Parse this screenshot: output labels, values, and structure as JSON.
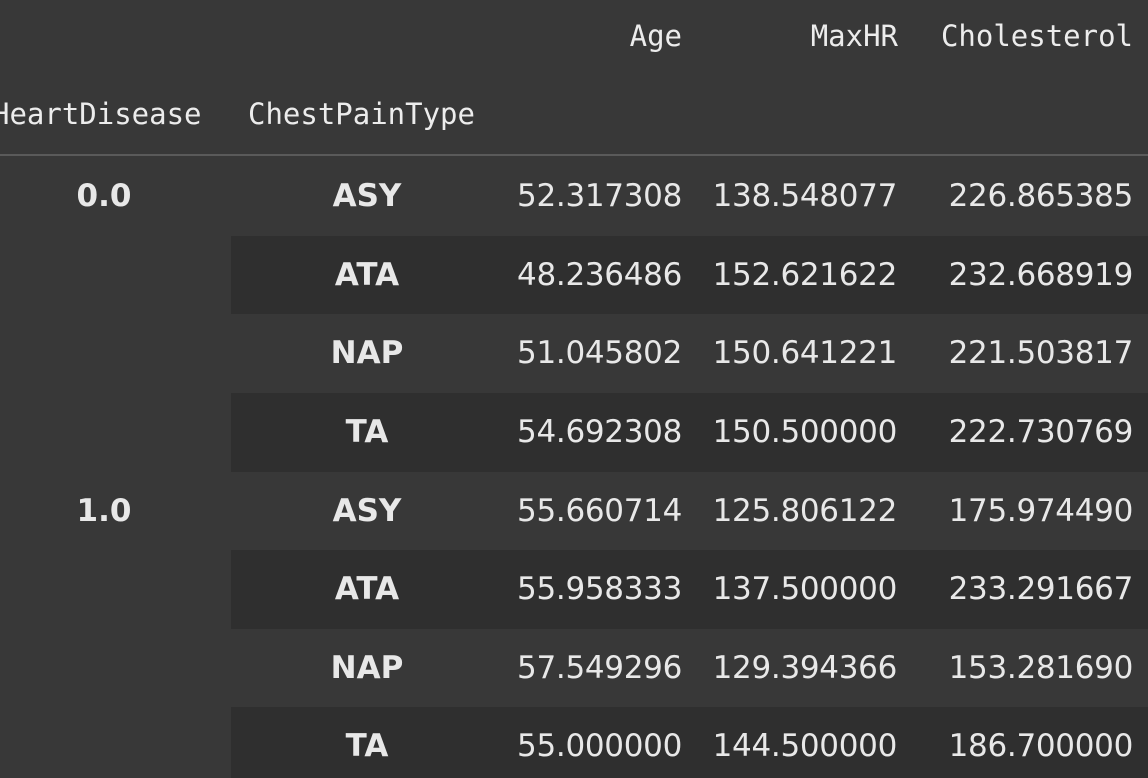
{
  "header": {
    "columns": [
      "Age",
      "MaxHR",
      "Cholesterol"
    ],
    "index_names": [
      "HeartDisease",
      "ChestPainType"
    ]
  },
  "rows": [
    {
      "HeartDisease": "0.0",
      "ChestPainType": "ASY",
      "Age": "52.317308",
      "MaxHR": "138.548077",
      "Cholesterol": "226.865385"
    },
    {
      "HeartDisease": "",
      "ChestPainType": "ATA",
      "Age": "48.236486",
      "MaxHR": "152.621622",
      "Cholesterol": "232.668919"
    },
    {
      "HeartDisease": "",
      "ChestPainType": "NAP",
      "Age": "51.045802",
      "MaxHR": "150.641221",
      "Cholesterol": "221.503817"
    },
    {
      "HeartDisease": "",
      "ChestPainType": "TA",
      "Age": "54.692308",
      "MaxHR": "150.500000",
      "Cholesterol": "222.730769"
    },
    {
      "HeartDisease": "1.0",
      "ChestPainType": "ASY",
      "Age": "55.660714",
      "MaxHR": "125.806122",
      "Cholesterol": "175.974490"
    },
    {
      "HeartDisease": "",
      "ChestPainType": "ATA",
      "Age": "55.958333",
      "MaxHR": "137.500000",
      "Cholesterol": "233.291667"
    },
    {
      "HeartDisease": "",
      "ChestPainType": "NAP",
      "Age": "57.549296",
      "MaxHR": "129.394366",
      "Cholesterol": "153.281690"
    },
    {
      "HeartDisease": "",
      "ChestPainType": "TA",
      "Age": "55.000000",
      "MaxHR": "144.500000",
      "Cholesterol": "186.700000"
    }
  ]
}
